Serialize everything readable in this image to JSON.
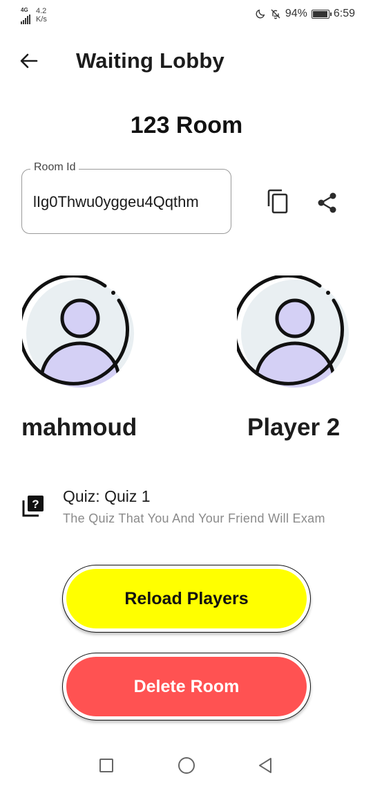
{
  "status_bar": {
    "network": "4G",
    "speed_value": "4.2",
    "speed_unit": "K/s",
    "battery": "94%",
    "time": "6:59",
    "battery_level": 0.94
  },
  "app_bar": {
    "title": "Waiting Lobby",
    "back_icon": "arrow-left-icon"
  },
  "room": {
    "title": "123 Room",
    "id_label": "Room Id",
    "id_value": "lIg0Thwu0yggeu4Qqthm",
    "copy_icon": "copy-icon",
    "share_icon": "share-icon"
  },
  "players": [
    {
      "name": "mahmoud",
      "avatar_icon": "user-avatar-icon"
    },
    {
      "name": "Player 2",
      "avatar_icon": "user-avatar-icon"
    }
  ],
  "quiz": {
    "title": "Quiz: Quiz 1",
    "subtitle": "The Quiz That You And Your Friend Will Exam",
    "icon": "quiz-library-icon"
  },
  "buttons": {
    "reload": "Reload Players",
    "delete": "Delete Room"
  },
  "colors": {
    "reload_bg": "#ffff00",
    "delete_bg": "#ff5252",
    "avatar_bg": "#e9eff2",
    "avatar_figure": "#d4d0f5"
  }
}
